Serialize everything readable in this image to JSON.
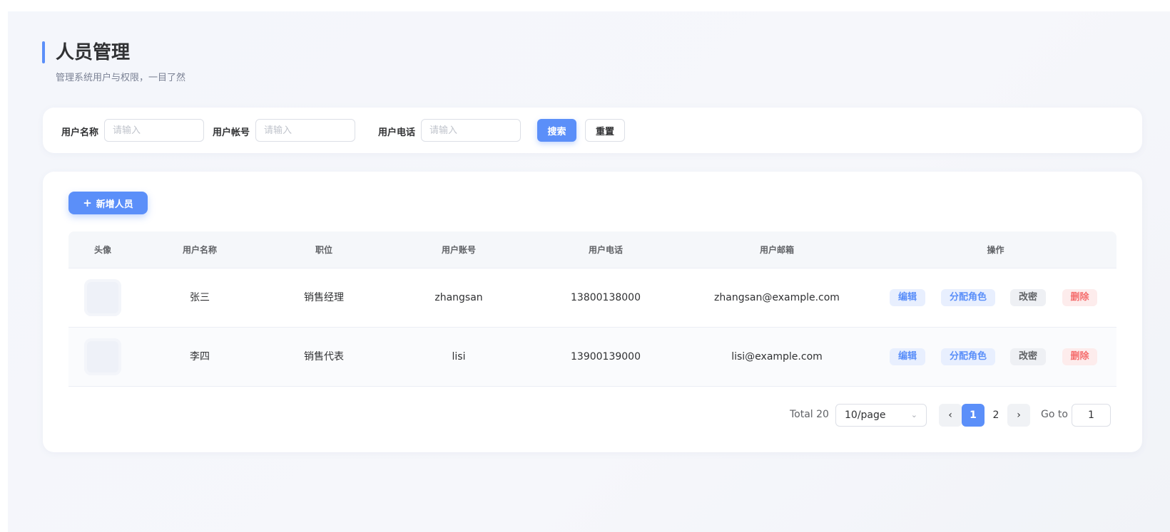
{
  "header": {
    "title": "人员管理",
    "subtitle": "管理系统用户与权限，一目了然"
  },
  "search": {
    "fields": [
      {
        "label": "用户名称",
        "placeholder": "请输入"
      },
      {
        "label": "用户帐号",
        "placeholder": "请输入"
      },
      {
        "label": "用户电话",
        "placeholder": "请输入"
      }
    ],
    "search_label": "搜索",
    "reset_label": "重置"
  },
  "toolbar": {
    "add_label": "新增人员",
    "add_icon": "plus-icon"
  },
  "table": {
    "columns": [
      "头像",
      "用户名称",
      "职位",
      "用户账号",
      "用户电话",
      "用户邮箱",
      "操作"
    ],
    "rows": [
      {
        "name": "张三",
        "position": "销售经理",
        "account": "zhangsan",
        "phone": "13800138000",
        "email": "zhangsan@example.com"
      },
      {
        "name": "李四",
        "position": "销售代表",
        "account": "lisi",
        "phone": "13900139000",
        "email": "lisi@example.com"
      }
    ],
    "actions": {
      "edit": "编辑",
      "assign_role": "分配角色",
      "change_password": "改密",
      "delete": "删除"
    }
  },
  "pagination": {
    "total_label": "Total 20",
    "page_size": "10/page",
    "pages": [
      "1",
      "2"
    ],
    "current_page": "1",
    "goto_label": "Go to",
    "goto_value": "1"
  },
  "colors": {
    "accent": "#5b8ff9",
    "danger": "#f56c6c"
  }
}
